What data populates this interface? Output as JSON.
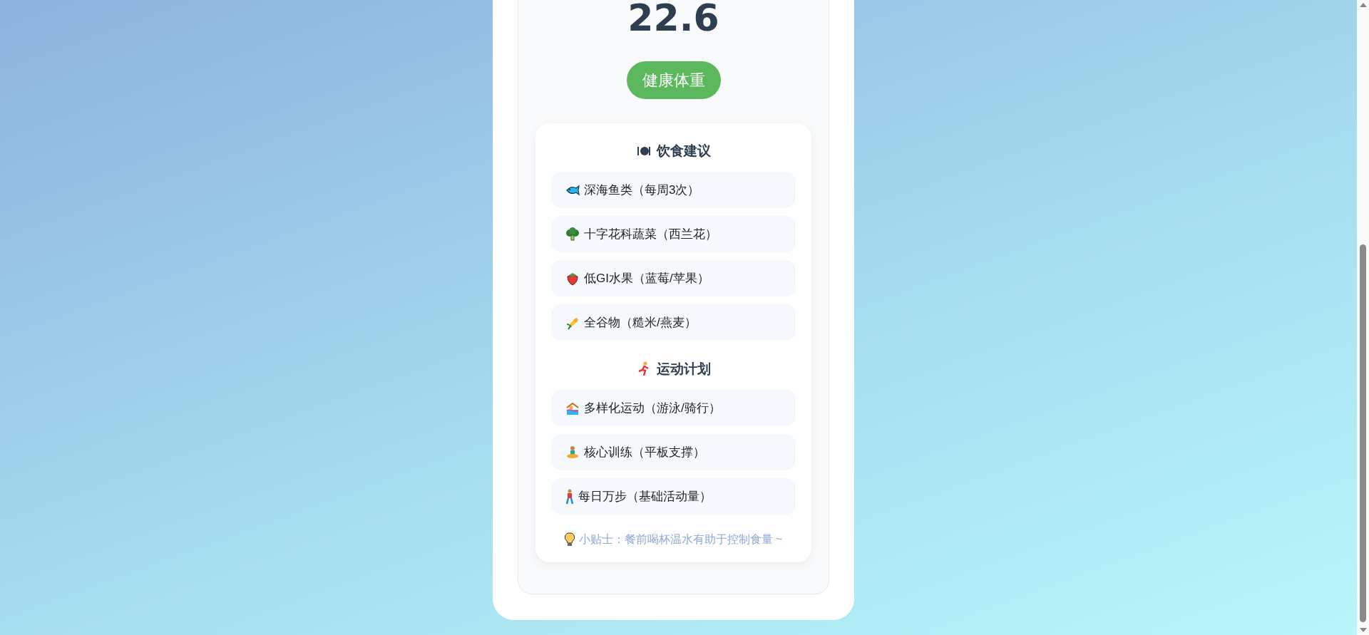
{
  "bmi": {
    "value": "22.6",
    "category": "健康体重"
  },
  "sections": [
    {
      "kind": "diet",
      "title": "饮食建议",
      "items": [
        "深海鱼类（每周3次）",
        "十字花科蔬菜（西兰花）",
        "低GI水果（蓝莓/苹果）",
        "全谷物（糙米/燕麦）"
      ]
    },
    {
      "kind": "exercise",
      "title": "运动计划",
      "items": [
        "多样化运动（游泳/骑行）",
        "核心训练（平板支撑）",
        "每日万步（基础活动量）"
      ]
    }
  ],
  "tip": "小贴士：餐前喝杯温水有助于控制食量 ~"
}
